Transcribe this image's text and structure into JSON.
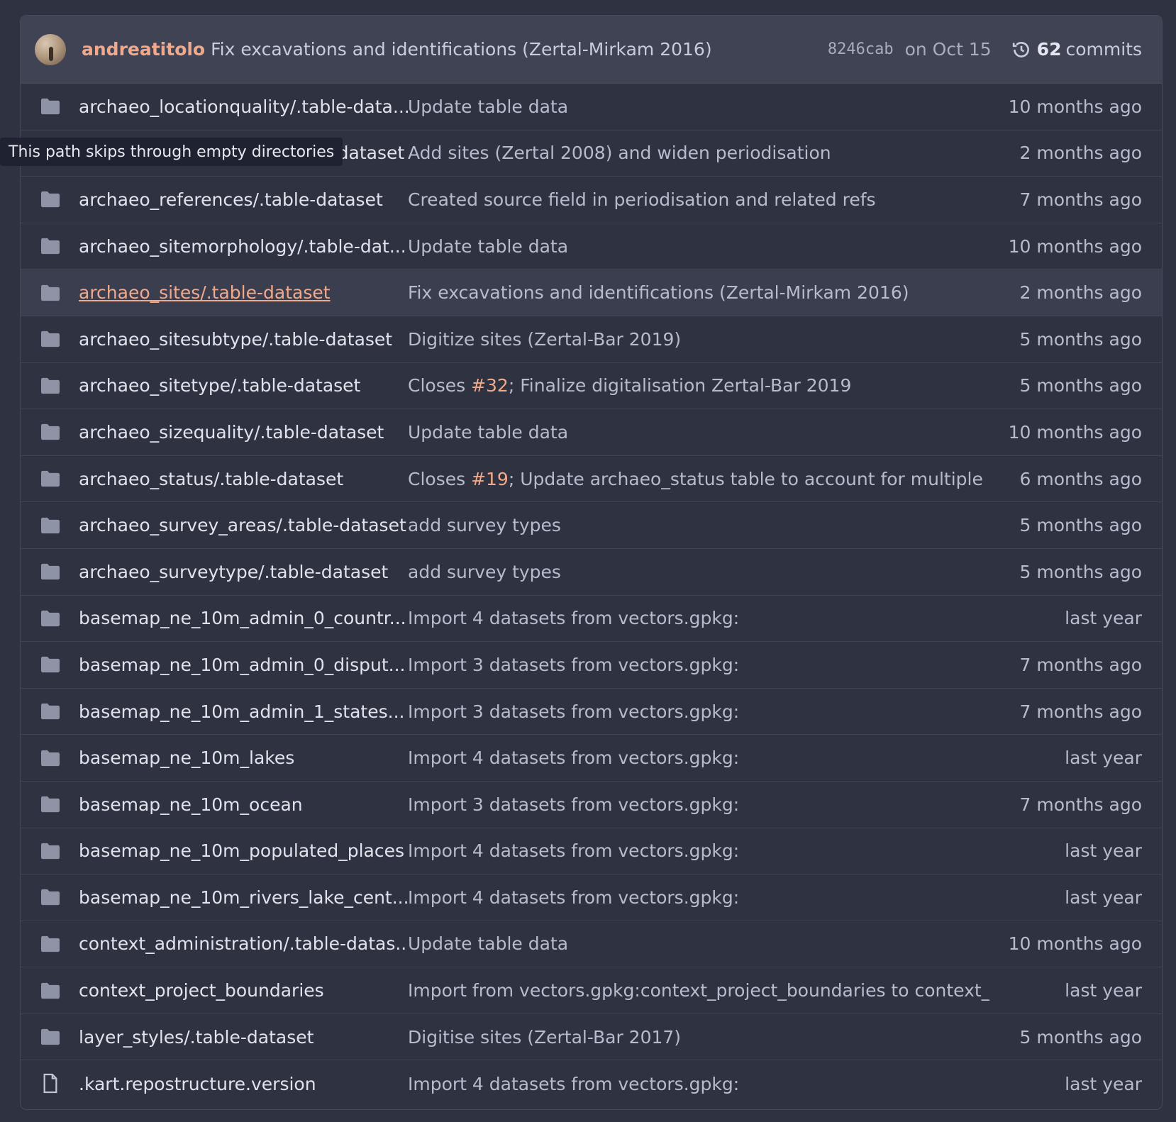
{
  "header": {
    "author": "andreatitolo",
    "message": "Fix excavations and identifications (Zertal-Mirkam 2016)",
    "sha": "8246cab",
    "date": "on Oct 15",
    "commit_count": "62",
    "commits_label": "commits",
    "history_icon": "history-icon"
  },
  "tooltip": "This path skips through empty directories",
  "rows": [
    {
      "icon": "folder-icon",
      "name": "archaeo_locationquality/.table-data...",
      "message": "Update table data",
      "time": "10 months ago"
    },
    {
      "icon": "folder-icon",
      "name": "archaeo_periodisation/.table-dataset",
      "message": "Add sites (Zertal 2008) and widen periodisation",
      "time": "2 months ago"
    },
    {
      "icon": "folder-icon",
      "name": "archaeo_references/.table-dataset",
      "message": "Created source field in periodisation and related refs",
      "time": "7 months ago"
    },
    {
      "icon": "folder-icon",
      "name": "archaeo_sitemorphology/.table-dat...",
      "message": "Update table data",
      "time": "10 months ago"
    },
    {
      "icon": "folder-icon",
      "name": "archaeo_sites/.table-dataset",
      "message": "Fix excavations and identifications (Zertal-Mirkam 2016)",
      "time": "2 months ago"
    },
    {
      "icon": "folder-icon",
      "name": "archaeo_sitesubtype/.table-dataset",
      "message": "Digitize sites (Zertal-Bar 2019)",
      "time": "5 months ago"
    },
    {
      "icon": "folder-icon",
      "name": "archaeo_sitetype/.table-dataset",
      "msg_prefix": "Closes ",
      "msg_issue": "#32",
      "msg_suffix": "; Finalize digitalisation Zertal-Bar 2019",
      "time": "5 months ago"
    },
    {
      "icon": "folder-icon",
      "name": "archaeo_sizequality/.table-dataset",
      "message": "Update table data",
      "time": "10 months ago"
    },
    {
      "icon": "folder-icon",
      "name": "archaeo_status/.table-dataset",
      "msg_prefix": "Closes ",
      "msg_issue": "#19",
      "msg_suffix": "; Update archaeo_status table to account for multiple ope...",
      "time": "6 months ago"
    },
    {
      "icon": "folder-icon",
      "name": "archaeo_survey_areas/.table-dataset",
      "message": "add survey types",
      "time": "5 months ago"
    },
    {
      "icon": "folder-icon",
      "name": "archaeo_surveytype/.table-dataset",
      "message": "add survey types",
      "time": "5 months ago"
    },
    {
      "icon": "folder-icon",
      "name": "basemap_ne_10m_admin_0_countr...",
      "message": "Import 4 datasets from vectors.gpkg:",
      "time": "last year"
    },
    {
      "icon": "folder-icon",
      "name": "basemap_ne_10m_admin_0_disput...",
      "message": "Import 3 datasets from vectors.gpkg:",
      "time": "7 months ago"
    },
    {
      "icon": "folder-icon",
      "name": "basemap_ne_10m_admin_1_states...",
      "message": "Import 3 datasets from vectors.gpkg:",
      "time": "7 months ago"
    },
    {
      "icon": "folder-icon",
      "name": "basemap_ne_10m_lakes",
      "message": "Import 4 datasets from vectors.gpkg:",
      "time": "last year"
    },
    {
      "icon": "folder-icon",
      "name": "basemap_ne_10m_ocean",
      "message": "Import 3 datasets from vectors.gpkg:",
      "time": "7 months ago"
    },
    {
      "icon": "folder-icon",
      "name": "basemap_ne_10m_populated_places",
      "message": "Import 4 datasets from vectors.gpkg:",
      "time": "last year"
    },
    {
      "icon": "folder-icon",
      "name": "basemap_ne_10m_rivers_lake_cent...",
      "message": "Import 4 datasets from vectors.gpkg:",
      "time": "last year"
    },
    {
      "icon": "folder-icon",
      "name": "context_administration/.table-datas...",
      "message": "Update table data",
      "time": "10 months ago"
    },
    {
      "icon": "folder-icon",
      "name": "context_project_boundaries",
      "message": "Import from vectors.gpkg:context_project_boundaries to context_pr...",
      "time": "last year"
    },
    {
      "icon": "folder-icon",
      "name": "layer_styles/.table-dataset",
      "message": "Digitise sites (Zertal-Bar 2017)",
      "time": "5 months ago"
    },
    {
      "icon": "file-icon",
      "name": ".kart.repostructure.version",
      "message": "Import 4 datasets from vectors.gpkg:",
      "time": "last year"
    }
  ]
}
